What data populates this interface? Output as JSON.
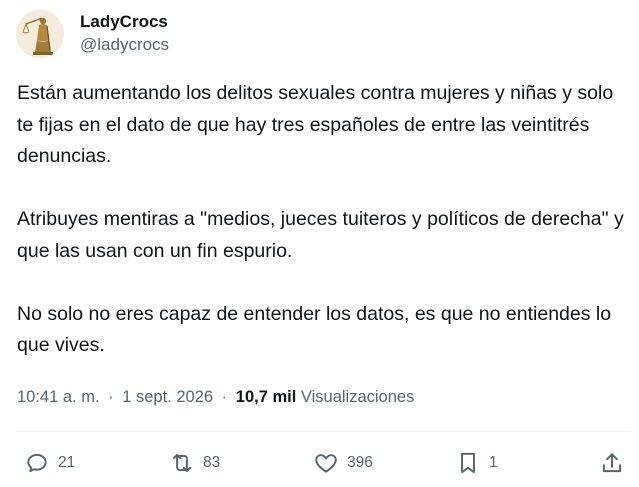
{
  "author": {
    "display_name": "LadyCrocs",
    "handle": "@ladycrocs"
  },
  "tweet": {
    "paragraphs": [
      "Están aumentando los delitos sexuales contra mujeres y niñas y solo te fijas en el dato de que hay tres españoles de entre las veintitrés denuncias.",
      "Atribuyes mentiras a \"medios, jueces tuiteros y políticos de derecha\" y que las usan con un fin espurio.",
      "No solo no eres capaz de entender los datos, es que no entiendes lo que vives."
    ]
  },
  "meta": {
    "time": "10:41 a. m.",
    "separator": "·",
    "date": "1 sept. 2026",
    "views_count": "10,7 mil",
    "views_label": "Visualizaciones"
  },
  "actions": {
    "replies": "21",
    "reposts": "83",
    "likes": "396",
    "bookmarks": "1"
  },
  "icons": {
    "reply": "reply-icon",
    "repost": "repost-icon",
    "like": "heart-icon",
    "bookmark": "bookmark-icon",
    "share": "share-icon"
  },
  "colors": {
    "text": "#0f1419",
    "secondary": "#536471",
    "divider": "#eff3f4"
  }
}
